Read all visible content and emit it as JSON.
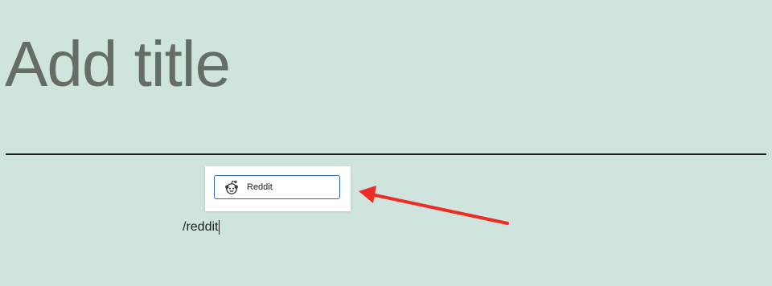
{
  "editor": {
    "title_placeholder": "Add title",
    "block_text": "/reddit"
  },
  "autocomplete": {
    "options": [
      {
        "label": "Reddit",
        "icon": "reddit-icon"
      }
    ]
  },
  "annotation": {
    "arrow_color": "#ee2b24"
  },
  "colors": {
    "background": "#cfe4dd",
    "focus_border": "#3066b7"
  }
}
